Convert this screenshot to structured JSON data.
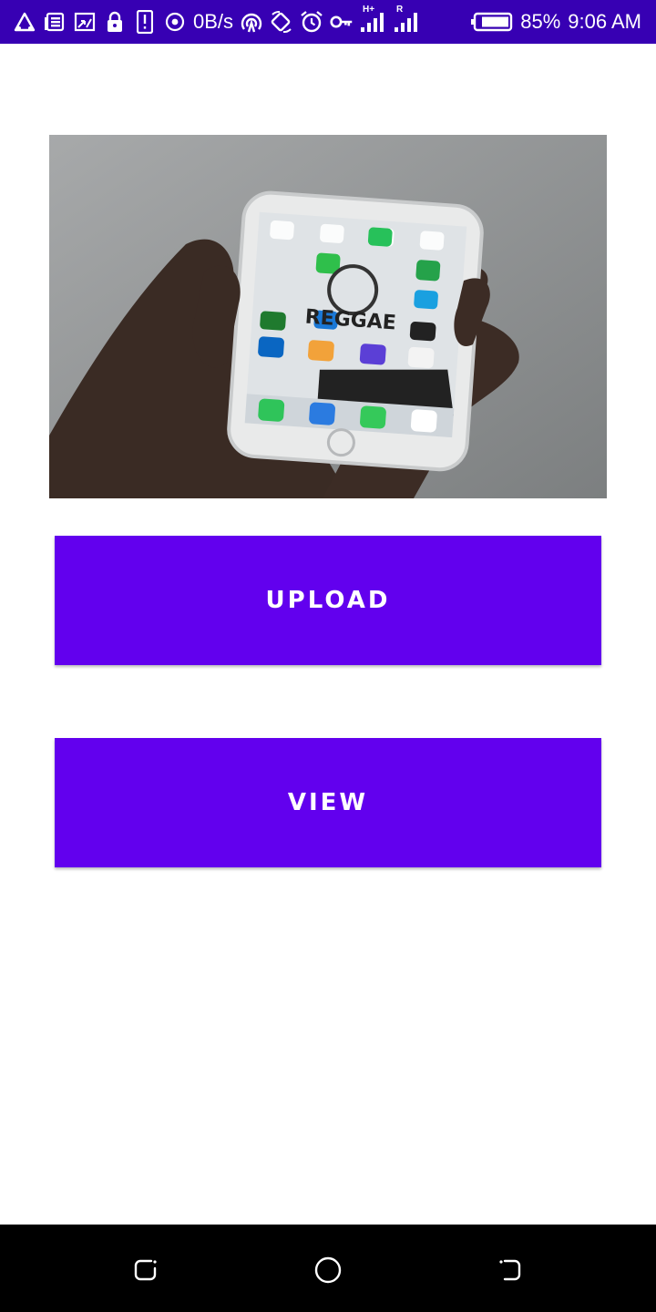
{
  "status_bar": {
    "net_speed": "0B/s",
    "battery_percent": "85%",
    "time": "9:06 AM",
    "network_label_1": "H+",
    "network_label_2": "R",
    "icons": [
      "alert-triangle-icon",
      "news-icon",
      "cast-icon",
      "lock-icon",
      "sim-alert-icon",
      "target-icon",
      "hotspot-icon",
      "rotate-icon",
      "alarm-icon",
      "vpn-key-icon",
      "signal-icon",
      "signal-icon",
      "battery-icon"
    ],
    "bg_color": "#3700b3"
  },
  "main": {
    "hero_image": "hand-holding-smartphone-photo",
    "upload_label": "UPLOAD",
    "view_label": "VIEW",
    "button_color": "#6200ee"
  },
  "nav_bar": {
    "icons": [
      "recents-icon",
      "home-icon",
      "back-icon"
    ]
  }
}
